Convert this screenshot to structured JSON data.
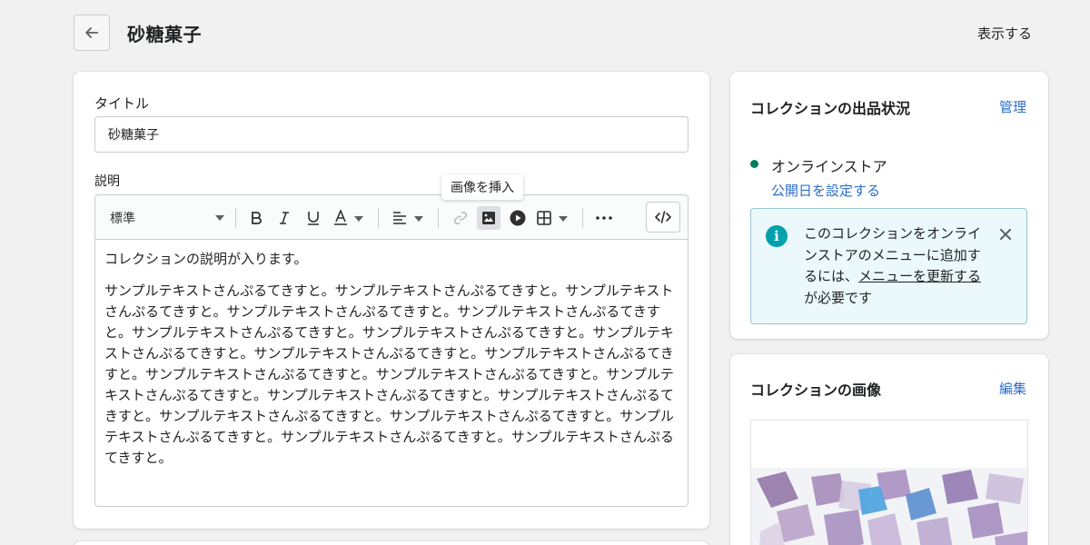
{
  "header": {
    "page_title": "砂糖菓子",
    "view_label": "表示する"
  },
  "main": {
    "title_label": "タイトル",
    "title_value": "砂糖菓子",
    "description_label": "説明",
    "tooltip": "画像を挿入",
    "toolbar": {
      "format_value": "標準",
      "icons": [
        "bold-icon",
        "italic-icon",
        "underline-icon",
        "text-color-icon",
        "align-icon",
        "link-icon",
        "insert-image-icon",
        "insert-video-icon",
        "table-icon",
        "more-icon",
        "code-icon"
      ]
    },
    "editor": {
      "paragraph1": "コレクションの説明が入ります。",
      "paragraph2": "サンプルテキストさんぷるてきすと。サンプルテキストさんぷるてきすと。サンプルテキストさんぷるてきすと。サンプルテキストさんぷるてきすと。サンプルテキストさんぷるてきすと。サンプルテキストさんぷるてきすと。サンプルテキストさんぷるてきすと。サンプルテキストさんぷるてきすと。サンプルテキストさんぷるてきすと。サンプルテキストさんぷるてきすと。サンプルテキストさんぷるてきすと。サンプルテキストさんぷるてきすと。サンプルテキストさんぷるてきすと。サンプルテキストさんぷるてきすと。サンプルテキストさんぷるてきすと。サンプルテキストさんぷるてきすと。サンプルテキストさんぷるてきすと。サンプルテキストさんぷるてきすと。サンプルテキストさんぷるてきすと。サンプルテキストさんぷるてきすと。"
    }
  },
  "status_card": {
    "heading": "コレクションの出品状況",
    "action": "管理",
    "channel": "オンラインストア",
    "schedule_link": "公開日を設定する",
    "banner": {
      "text_before": "このコレクションをオンラインストアのメニューに追加するには、",
      "link": "メニューを更新する",
      "text_after": "が必要です"
    }
  },
  "image_card": {
    "heading": "コレクションの画像",
    "action": "編集"
  },
  "colors": {
    "accent_link": "#2c6ecb",
    "status_dot": "#007f5f",
    "info_banner_bg": "#ebf9fc",
    "info_icon": "#00a0ac"
  }
}
